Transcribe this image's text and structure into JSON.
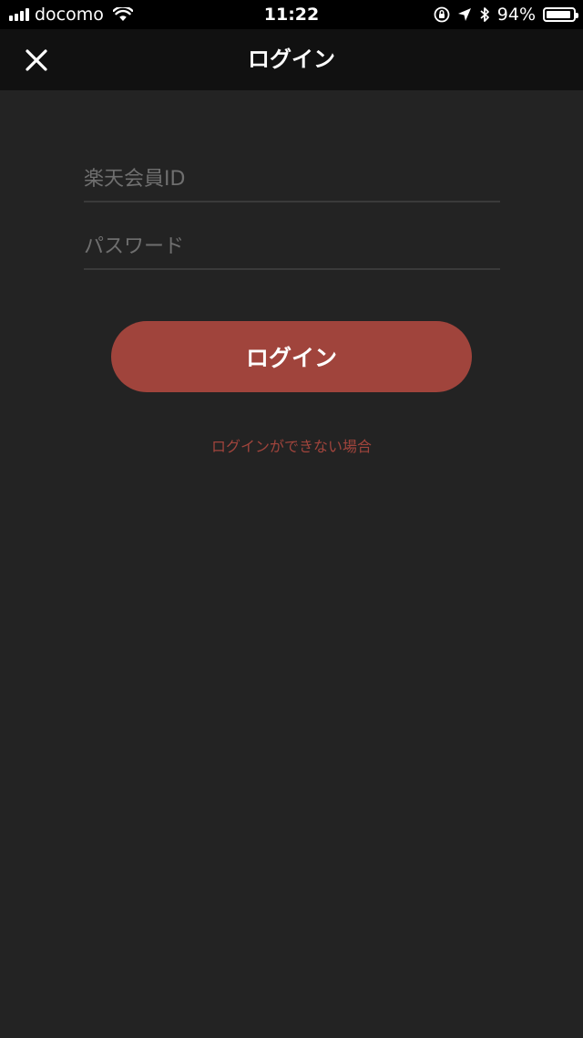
{
  "status_bar": {
    "carrier": "docomo",
    "time": "11:22",
    "battery_percent_label": "94%",
    "battery_level": 0.94,
    "icons": [
      "signal-icon",
      "wifi-icon",
      "orientation-lock-icon",
      "location-icon",
      "bluetooth-icon",
      "battery-icon"
    ]
  },
  "nav": {
    "title": "ログイン",
    "close_icon": "close-icon"
  },
  "form": {
    "member_id": {
      "placeholder": "楽天会員ID",
      "value": ""
    },
    "password": {
      "placeholder": "パスワード",
      "value": ""
    },
    "login_button_label": "ログイン",
    "help_link": "ログインができない場合"
  },
  "colors": {
    "background": "#232323",
    "nav_background": "#111111",
    "status_background": "#000000",
    "accent": "#a0443c",
    "divider": "#3a3a3a",
    "placeholder": "#6f6f6f"
  }
}
